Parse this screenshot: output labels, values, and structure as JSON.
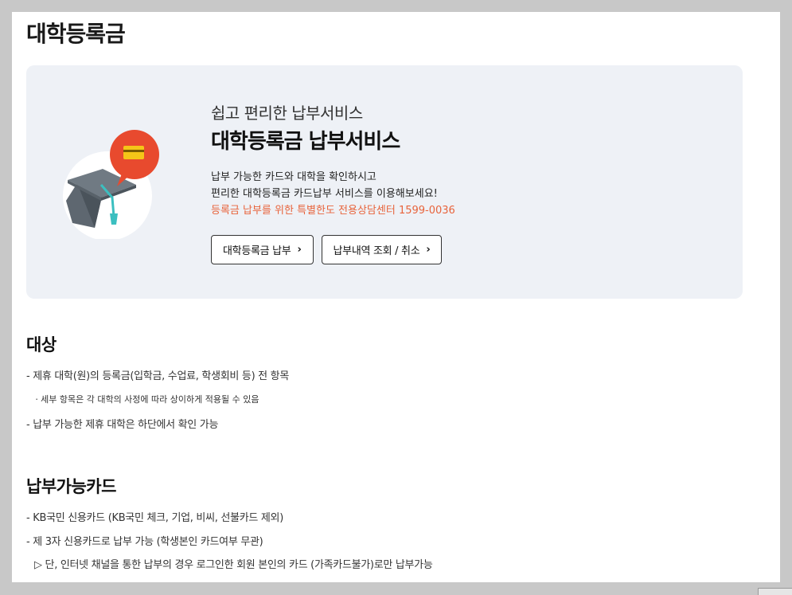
{
  "page": {
    "title": "대학등록금"
  },
  "banner": {
    "subtitle": "쉽고 편리한 납부서비스",
    "headline": "대학등록금 납부서비스",
    "desc_line1": "납부 가능한 카드와 대학을 확인하시고",
    "desc_line2": "편리한 대학등록금 카드납부 서비스를 이용해보세요!",
    "desc_highlight": "등록금 납부를 위한 특별한도 전용상담센터 1599-0036",
    "highlight_color": "#e8643c",
    "buttons": [
      {
        "label": "대학등록금 납부",
        "icon": "chevron-right-icon"
      },
      {
        "label": "납부내역 조회 / 취소",
        "icon": "chevron-right-icon"
      }
    ]
  },
  "target": {
    "title": "대상",
    "items": [
      "- 제휴 대학(원)의 등록금(입학금, 수업료, 학생회비 등) 전 항목",
      "ㆍ세부 항목은 각 대학의 사정에 따라 상이하게 적용될 수 있음",
      "- 납부 가능한 제휴 대학은 하단에서 확인 가능"
    ]
  },
  "cards": {
    "title": "납부가능카드",
    "items": [
      "- KB국민 신용카드 (KB국민 체크, 기업, 비씨, 선불카드 제외)",
      "- 제 3자 신용카드로 납부 가능 (학생본인 카드여부 무관)",
      "▷ 단, 인터넷 채널을 통한 납부의 경우 로그인한 회원 본인의 카드 (가족카드불가)로만 납부가능"
    ]
  }
}
